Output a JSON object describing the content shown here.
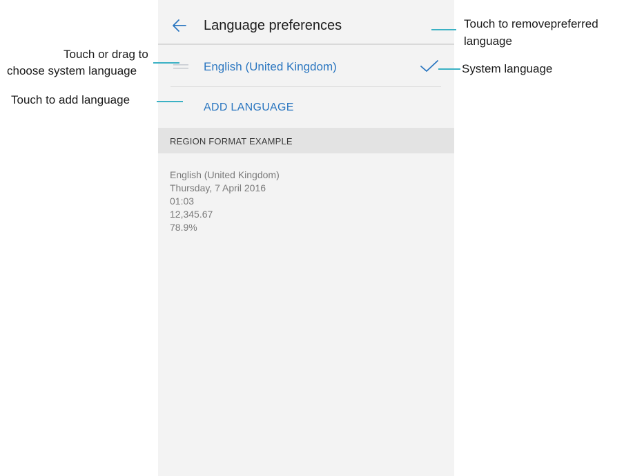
{
  "screen": {
    "app_bar": {
      "title": "Language preferences",
      "back_icon": "arrow-left-icon"
    },
    "languages": [
      {
        "label": "English (United Kingdom)",
        "drag_icon": "drag-handle-icon",
        "check_icon": "checkmark-icon"
      }
    ],
    "add_language_label": "ADD LANGUAGE",
    "region_section": {
      "header": "REGION FORMAT EXAMPLE",
      "lines": [
        "English (United Kingdom)",
        "Thursday, 7 April 2016",
        "01:03",
        "12,345.67",
        "78.9%"
      ]
    }
  },
  "callouts": {
    "drag_line1": "Touch or drag to",
    "drag_line2": "choose system language",
    "add": "Touch to add language",
    "remove_line1": "Touch to removepreferred",
    "remove_line2": "language",
    "system": "System language"
  },
  "colors": {
    "accent": "#2a76c0",
    "leader_line": "#3bb1c4",
    "screen_background": "#f3f3f3",
    "section_header_background": "#e3e3e3"
  }
}
